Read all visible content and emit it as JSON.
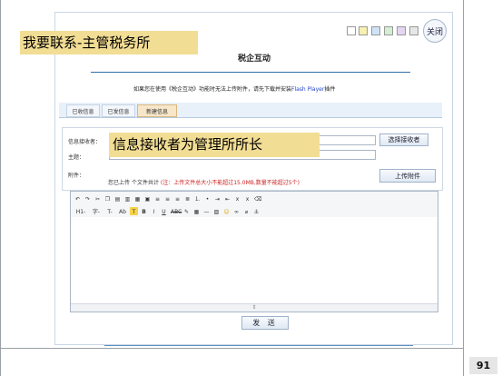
{
  "callouts": {
    "top": "我要联系-主管税务所",
    "middle": "信息接收者为管理所所长"
  },
  "window": {
    "close_label": "关闭",
    "title": "税企互动",
    "notice_prefix": "如果您在使用《税企互动》功能时无法上传附件，请先下载并安装",
    "notice_link": "Flash Player",
    "notice_suffix": "插件"
  },
  "tabs": [
    {
      "label": "已收信息",
      "active": false
    },
    {
      "label": "已发信息",
      "active": false
    },
    {
      "label": "新建信息",
      "active": true
    }
  ],
  "form": {
    "receiver_label": "信息接收者：",
    "subject_label": "主题：",
    "attachment_label": "附件：",
    "select_receiver_button": "选择接收者",
    "upload_button": "上传附件",
    "attach_count": "您已上传",
    "attach_count_tail": "个文件共计",
    "attach_warning": "(注：上传文件总大小不能超过15.0MB,数量不能超过5个)"
  },
  "editor": {
    "toolbar_row2_text": [
      "H1-",
      "字-",
      "T-",
      "Ab",
      "T",
      "B",
      "I",
      "U",
      "ABC"
    ]
  },
  "send_button": "发 送",
  "page_number": "91"
}
